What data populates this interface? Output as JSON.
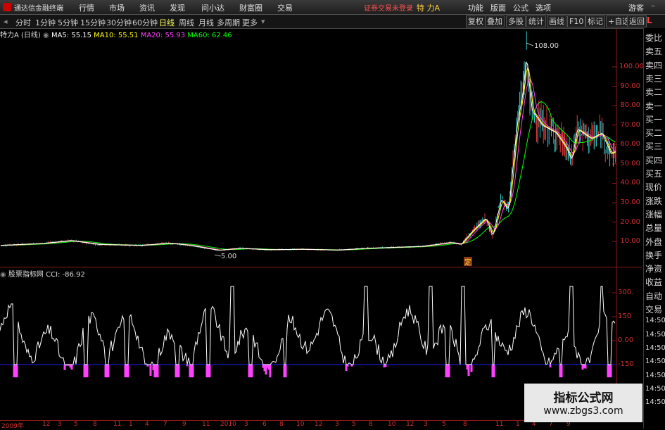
{
  "menubar": {
    "app_title": "通达信金融终端",
    "items": [
      "行情",
      "市场",
      "资讯",
      "发现",
      "问小达",
      "财富圈",
      "交易"
    ],
    "login_status": "证券交易未登录",
    "stock_name": "特 力A",
    "right_items": [
      "功能",
      "版面",
      "公式",
      "选项"
    ],
    "user": "游客"
  },
  "periodbar": {
    "periods": [
      "分时",
      "1分钟",
      "5分钟",
      "15分钟",
      "30分钟",
      "60分钟",
      "日线",
      "周线",
      "月线",
      "多周期",
      "更多"
    ],
    "selected": "日线",
    "right_buttons": [
      "复权",
      "叠加",
      "多股",
      "统计",
      "画线",
      "F10",
      "标记",
      "+自选",
      "返回"
    ]
  },
  "main_chart": {
    "stock_label": "特力A",
    "period_label": "(日线)",
    "ma5": "MA5: 55.15",
    "ma10": "MA10: 55.51",
    "ma20": "MA20: 55.93",
    "ma60": "MA60: 62.46",
    "high_label": "108.00",
    "low_label": "5.00",
    "event_marker": "定",
    "y_ticks": [
      "100.00",
      "90.00",
      "80.00",
      "70.00",
      "60.00",
      "50.00",
      "40.00",
      "30.00",
      "20.00",
      "10.00"
    ]
  },
  "sub_chart": {
    "title": "股票指标网",
    "cci_label": "CCI: -86.92",
    "y_ticks": [
      "300.",
      "150",
      "0.00",
      "-150"
    ]
  },
  "right_panel": {
    "corner": "L",
    "items": [
      "委比",
      "卖五",
      "卖四",
      "卖三",
      "卖二",
      "卖一",
      "买一",
      "买二",
      "买三",
      "买四",
      "买五",
      "现价",
      "涨跌",
      "涨幅",
      "总量",
      "外盘",
      "换手",
      "净资",
      "收益",
      "自动",
      "交易",
      "14:50",
      "14:50",
      "14:50",
      "14:50",
      "14:50",
      "14:50",
      "14:50"
    ]
  },
  "date_axis": {
    "labels": [
      "2009年",
      "12",
      "3",
      "5",
      "8",
      "11",
      "1",
      "4",
      "7",
      "9",
      "11",
      "2010",
      "3",
      "6",
      "8",
      "10",
      "12",
      "3",
      "5",
      "8",
      "10",
      "12",
      "3",
      "5",
      "8",
      "11",
      "1",
      "4",
      "7",
      "9"
    ]
  },
  "watermark": {
    "title": "指标公式网",
    "url": "www.zbgs3.com"
  },
  "colors": {
    "ma5": "#ffffff",
    "ma10": "#ffff00",
    "ma20": "#ff40ff",
    "ma60": "#00ff00",
    "cci_line": "#ffffff",
    "cci_negative": "#ff40ff",
    "axis_red": "#d03030",
    "baseline_blue": "#2020ff"
  }
}
